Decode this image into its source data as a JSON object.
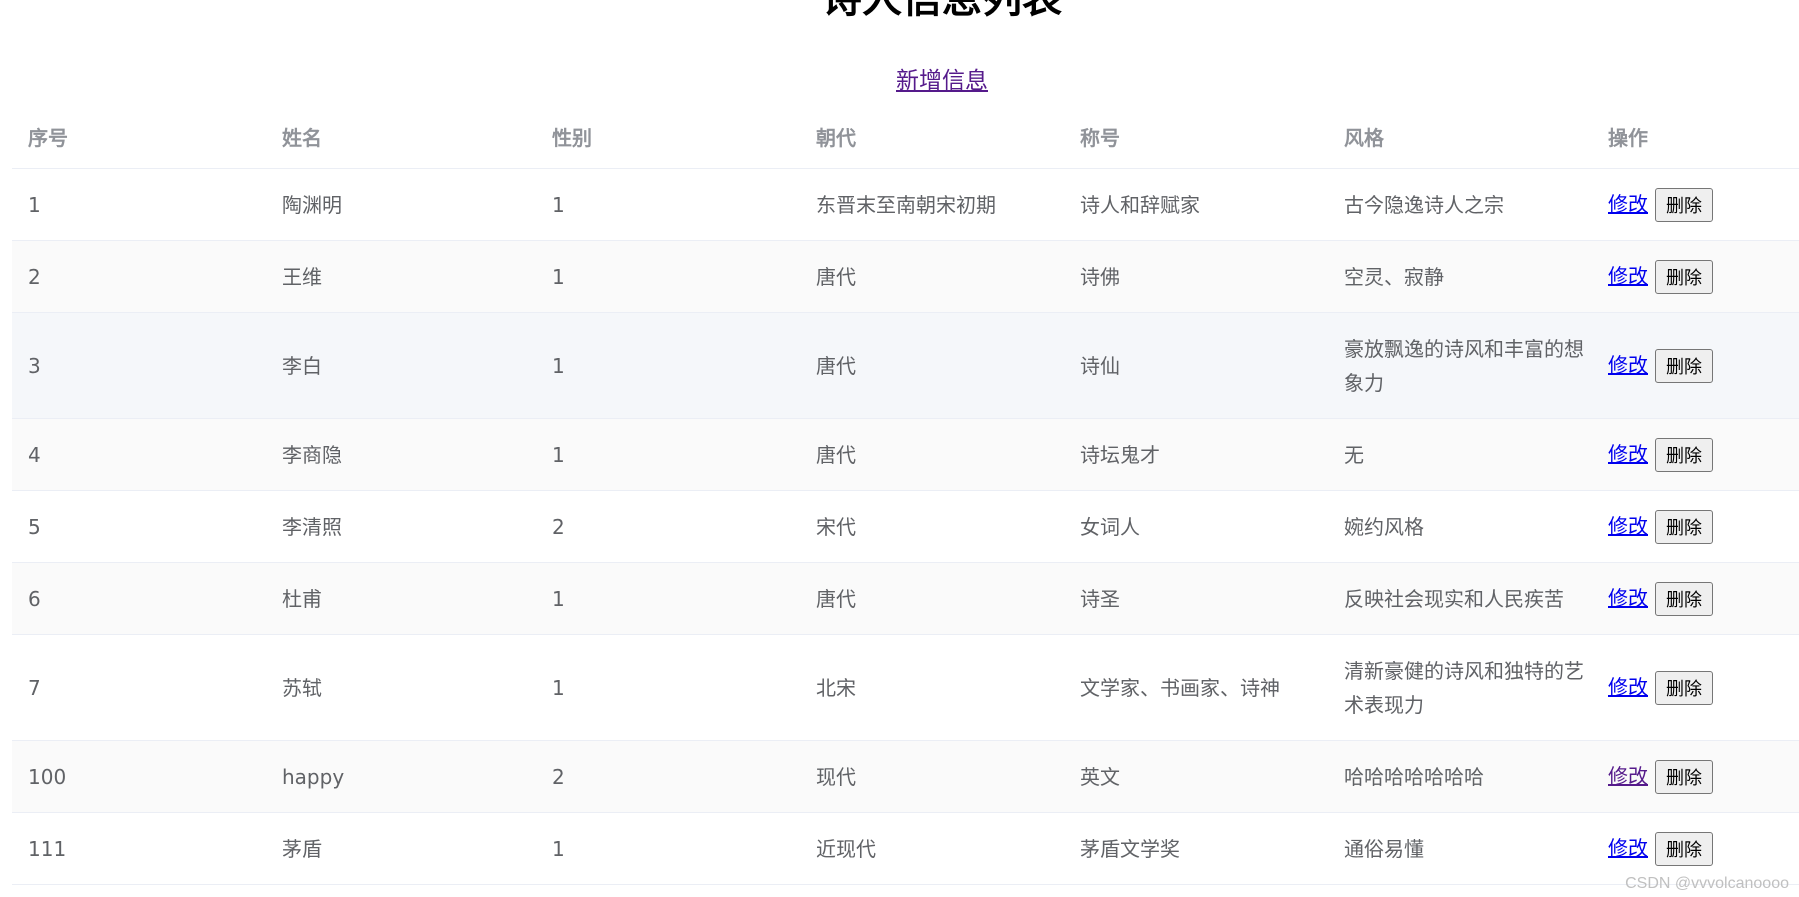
{
  "page": {
    "title": "诗人信息列表",
    "add_link_label": "新增信息",
    "watermark": "CSDN @vvvolcanoooo"
  },
  "table": {
    "headers": [
      "序号",
      "姓名",
      "性别",
      "朝代",
      "称号",
      "风格",
      "操作"
    ],
    "edit_label": "修改",
    "delete_label": "删除",
    "rows": [
      {
        "id": "1",
        "name": "陶渊明",
        "gender": "1",
        "dynasty": "东晋末至南朝宋初期",
        "honor": "诗人和辞赋家",
        "style": "古今隐逸诗人之宗"
      },
      {
        "id": "2",
        "name": "王维",
        "gender": "1",
        "dynasty": "唐代",
        "honor": "诗佛",
        "style": "空灵、寂静"
      },
      {
        "id": "3",
        "name": "李白",
        "gender": "1",
        "dynasty": "唐代",
        "honor": "诗仙",
        "style": "豪放飘逸的诗风和丰富的想象力"
      },
      {
        "id": "4",
        "name": "李商隐",
        "gender": "1",
        "dynasty": "唐代",
        "honor": "诗坛鬼才",
        "style": "无"
      },
      {
        "id": "5",
        "name": "李清照",
        "gender": "2",
        "dynasty": "宋代",
        "honor": "女词人",
        "style": "婉约风格"
      },
      {
        "id": "6",
        "name": "杜甫",
        "gender": "1",
        "dynasty": "唐代",
        "honor": "诗圣",
        "style": "反映社会现实和人民疾苦"
      },
      {
        "id": "7",
        "name": "苏轼",
        "gender": "1",
        "dynasty": "北宋",
        "honor": "文学家、书画家、诗神",
        "style": "清新豪健的诗风和独特的艺术表现力"
      },
      {
        "id": "100",
        "name": "happy",
        "gender": "2",
        "dynasty": "现代",
        "honor": "英文",
        "style": "哈哈哈哈哈哈哈"
      },
      {
        "id": "111",
        "name": "茅盾",
        "gender": "1",
        "dynasty": "近现代",
        "honor": "茅盾文学奖",
        "style": "通俗易懂"
      }
    ]
  },
  "colors": {
    "header_text": "#909399",
    "body_text": "#606266",
    "row_border": "#ebeef5",
    "striped_row": "#fafafa",
    "hover_row": "#f5f7fa",
    "link": "#0000ee",
    "visited_link": "#551a8b"
  }
}
